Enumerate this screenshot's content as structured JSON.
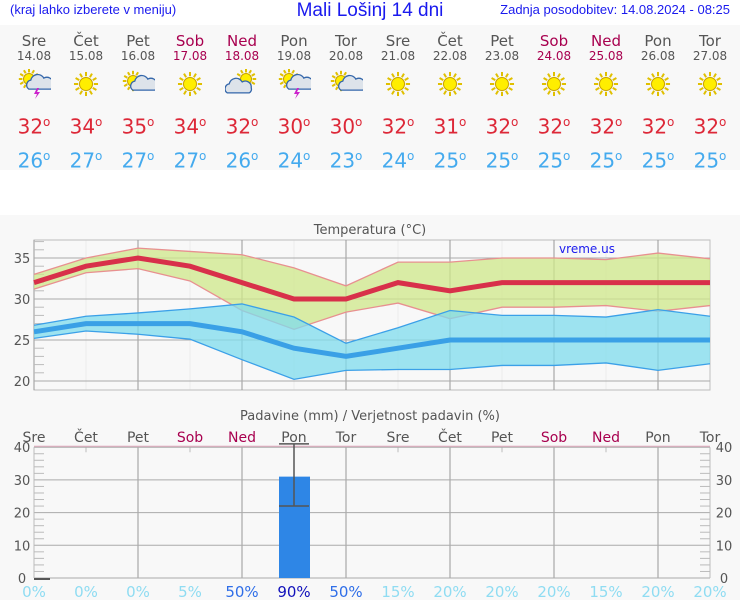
{
  "header": {
    "hint": "(kraj lahko izberete v meniju)",
    "title": "Mali Lošinj 14 dni",
    "updated": "Zadnja posodobitev: 14.08.2024 - 08:25"
  },
  "days": [
    {
      "name": "Sre",
      "date": "14.08",
      "weekend": false,
      "icon": "sun-cloud-storm-icon",
      "max": "32",
      "min": "26"
    },
    {
      "name": "Čet",
      "date": "15.08",
      "weekend": false,
      "icon": "sun-icon",
      "max": "34",
      "min": "27"
    },
    {
      "name": "Pet",
      "date": "16.08",
      "weekend": false,
      "icon": "sun-cloud-icon",
      "max": "35",
      "min": "27"
    },
    {
      "name": "Sob",
      "date": "17.08",
      "weekend": true,
      "icon": "sun-icon",
      "max": "34",
      "min": "27"
    },
    {
      "name": "Ned",
      "date": "18.08",
      "weekend": true,
      "icon": "cloud-sun-icon",
      "max": "32",
      "min": "26"
    },
    {
      "name": "Pon",
      "date": "19.08",
      "weekend": false,
      "icon": "sun-cloud-storm-icon",
      "max": "30",
      "min": "24"
    },
    {
      "name": "Tor",
      "date": "20.08",
      "weekend": false,
      "icon": "sun-cloud-icon",
      "max": "30",
      "min": "23"
    },
    {
      "name": "Sre",
      "date": "21.08",
      "weekend": false,
      "icon": "sun-icon",
      "max": "32",
      "min": "24"
    },
    {
      "name": "Čet",
      "date": "22.08",
      "weekend": false,
      "icon": "sun-icon",
      "max": "31",
      "min": "25"
    },
    {
      "name": "Pet",
      "date": "23.08",
      "weekend": false,
      "icon": "sun-icon",
      "max": "32",
      "min": "25"
    },
    {
      "name": "Sob",
      "date": "24.08",
      "weekend": true,
      "icon": "sun-icon",
      "max": "32",
      "min": "25"
    },
    {
      "name": "Ned",
      "date": "25.08",
      "weekend": true,
      "icon": "sun-icon",
      "max": "32",
      "min": "25"
    },
    {
      "name": "Pon",
      "date": "26.08",
      "weekend": false,
      "icon": "sun-icon",
      "max": "32",
      "min": "25"
    },
    {
      "name": "Tor",
      "date": "27.08",
      "weekend": false,
      "icon": "sun-icon",
      "max": "32",
      "min": "25"
    }
  ],
  "degree_symbol": "o",
  "colors": {
    "max": "#dd2838",
    "min": "#44aaee",
    "weekend": "#a8004f",
    "bar": "#2e86e6"
  },
  "chart_data": [
    {
      "type": "area",
      "title": "Temperatura (°C)",
      "watermark": "vreme.us",
      "ylim": [
        19,
        37.5
      ],
      "yticks": [
        20,
        25,
        30,
        35
      ],
      "grid": true,
      "series": [
        {
          "role": "max",
          "values": [
            32,
            34,
            35,
            34,
            32,
            30,
            30,
            32,
            31,
            32,
            32,
            32,
            32,
            32
          ]
        },
        {
          "role": "max-range-high",
          "values": [
            33,
            35,
            36.2,
            35.8,
            35.4,
            33.8,
            31.6,
            34.5,
            34.5,
            35,
            35,
            34.8,
            35.6,
            34.9
          ]
        },
        {
          "role": "max-range-low",
          "values": [
            31.2,
            33.2,
            33.7,
            32.2,
            28.6,
            26.3,
            28.4,
            29.5,
            27.6,
            29,
            29,
            29.2,
            28.5,
            29.2
          ]
        },
        {
          "role": "min",
          "values": [
            26,
            27,
            27,
            27,
            26,
            24,
            23,
            24,
            25,
            25,
            25,
            25,
            25,
            25
          ]
        },
        {
          "role": "min-range-high",
          "values": [
            26.8,
            27.9,
            28.3,
            28.8,
            29.4,
            27.8,
            24.6,
            26.5,
            28.6,
            28,
            28,
            27.8,
            28.7,
            27.9
          ]
        },
        {
          "role": "min-range-low",
          "values": [
            25.2,
            26.1,
            25.7,
            25.1,
            22.6,
            20.2,
            21.3,
            21.4,
            21.4,
            21.9,
            21.9,
            22.2,
            21.3,
            22.1
          ]
        }
      ]
    },
    {
      "type": "bar",
      "title": "Padavine (mm) / Verjetnost padavin (%)",
      "ylim": [
        0,
        40
      ],
      "yticks": [
        0,
        10,
        20,
        30,
        40
      ],
      "categories": [
        "Sre",
        "Čet",
        "Pet",
        "Sob",
        "Ned",
        "Pon",
        "Tor",
        "Sre",
        "Čet",
        "Pet",
        "Sob",
        "Ned",
        "Pon",
        "Tor"
      ],
      "values": [
        0,
        0,
        0,
        0,
        0,
        31,
        0,
        0,
        0,
        0,
        0,
        0,
        0,
        0
      ],
      "error": [
        null,
        null,
        null,
        null,
        null,
        [
          22,
          41
        ],
        null,
        null,
        null,
        null,
        null,
        null,
        null,
        null
      ],
      "probability": [
        "0%",
        "0%",
        "0%",
        "5%",
        "50%",
        "90%",
        "50%",
        "15%",
        "20%",
        "20%",
        "20%",
        "15%",
        "20%",
        "20%"
      ]
    }
  ]
}
